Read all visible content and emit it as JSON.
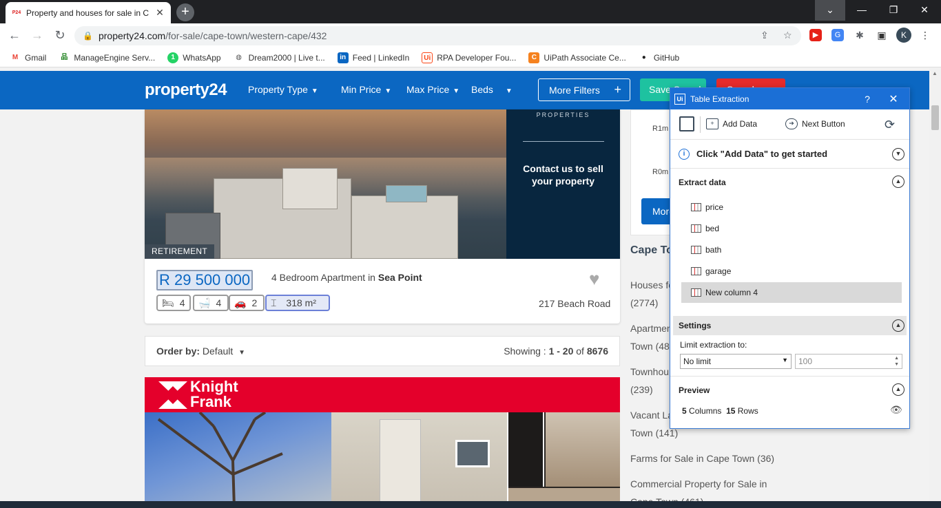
{
  "browser": {
    "tab_title": "Property and houses for sale in C",
    "tab_favicon": "P24",
    "url_host": "property24.com",
    "url_path": "/for-sale/cape-town/western-cape/432",
    "profile_initial": "K"
  },
  "bookmarks": [
    {
      "label": "Gmail",
      "icon": "gmail-icon",
      "glyph": "M",
      "color": "#ea4335"
    },
    {
      "label": "ManageEngine Serv...",
      "icon": "manageengine-icon",
      "glyph": "品",
      "color": "#1a7f1a"
    },
    {
      "label": "WhatsApp",
      "icon": "whatsapp-icon",
      "glyph": "1",
      "color": "#25d366"
    },
    {
      "label": "Dream2000 | Live t...",
      "icon": "globe-icon",
      "glyph": "◍",
      "color": "#555555"
    },
    {
      "label": "Feed | LinkedIn",
      "icon": "linkedin-icon",
      "glyph": "in",
      "color": "#0a66c2"
    },
    {
      "label": "RPA Developer Fou...",
      "icon": "uipath-icon",
      "glyph": "Ui",
      "color": "#fa4616"
    },
    {
      "label": "UiPath Associate Ce...",
      "icon": "uipath-cert-icon",
      "glyph": "C",
      "color": "#f5821f"
    },
    {
      "label": "GitHub",
      "icon": "github-icon",
      "glyph": "●",
      "color": "#222222"
    }
  ],
  "site": {
    "logo": "property24",
    "nav": [
      "Property Type",
      "Min Price",
      "Max Price",
      "Beds"
    ],
    "more_filters": "More Filters",
    "save_search": "Save Search",
    "red_button": "Search"
  },
  "listing": {
    "promo_small": "PROPERTIES",
    "promo_big": "Contact us to sell your property",
    "badge": "RETIREMENT",
    "price": "R 29 500 000",
    "title_prefix": "4 Bedroom Apartment in",
    "suburb": "Sea Point",
    "beds": "4",
    "baths": "4",
    "garages": "2",
    "size": "318 m²",
    "address": "217 Beach Road"
  },
  "order_bar": {
    "label": "Order by:",
    "value": "Default",
    "showing_label": "Showing :",
    "showing_range": "1 - 20",
    "of": "of",
    "total": "8676"
  },
  "listing2": {
    "agency_line1": "Knight",
    "agency_line2": "Frank"
  },
  "sidebar": {
    "tick_top": "R1m",
    "tick_bottom": "R0m",
    "more_btn": "More",
    "heading": "Cape To",
    "links": [
      {
        "line1": "Houses fo",
        "line2": "(2774)"
      },
      {
        "line1": "Apartmen",
        "line2": "Town (48"
      },
      {
        "line1": "Townhou",
        "line2": "(239)"
      },
      {
        "line1": "Vacant La",
        "line2": "Town (141)"
      },
      {
        "line1": "Farms for Sale in Cape Town (36)",
        "line2": ""
      },
      {
        "line1": "Commercial Property for Sale in",
        "line2": "Cape Town (461)"
      }
    ]
  },
  "panel": {
    "app_badge": "Ui",
    "title": "Table Extraction",
    "help": "?",
    "add_data": "Add Data",
    "next_button": "Next Button",
    "info": "Click \"Add Data\" to get started",
    "extract_heading": "Extract data",
    "columns": [
      "price",
      "bed",
      "bath",
      "garage",
      "New column 4"
    ],
    "settings_heading": "Settings",
    "limit_label": "Limit extraction to:",
    "limit_value": "No limit",
    "limit_number": "100",
    "preview_heading": "Preview",
    "columns_count": "5",
    "columns_word": "Columns",
    "rows_count": "15",
    "rows_word": "Rows"
  }
}
